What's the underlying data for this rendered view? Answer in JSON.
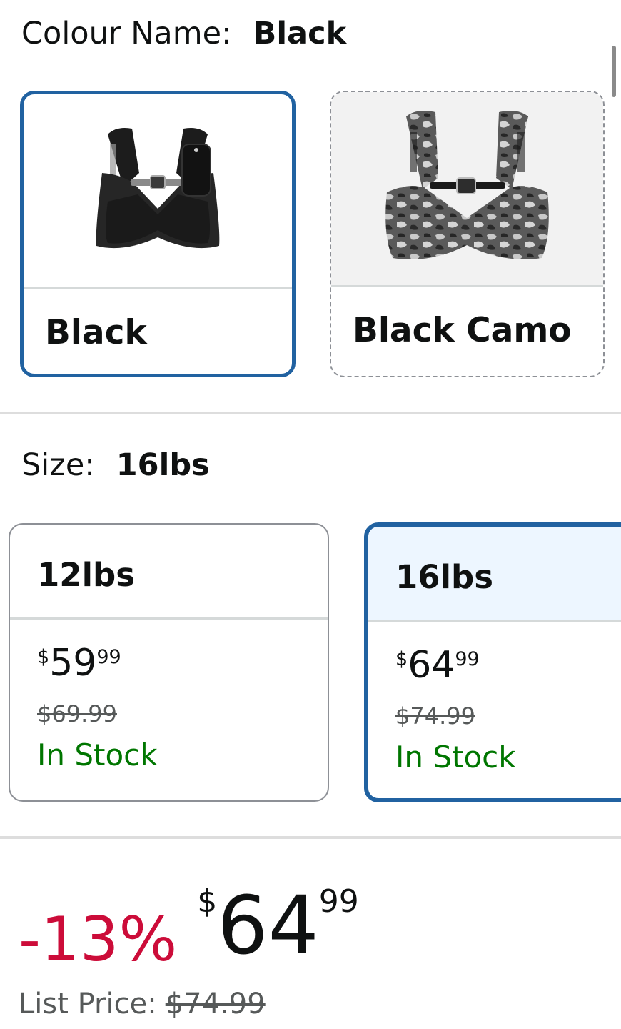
{
  "colour": {
    "label": "Colour Name:",
    "selected": "Black",
    "options": [
      {
        "name": "Black",
        "icon": "weight-vest-black-image",
        "state": "selected"
      },
      {
        "name": "Black Camo",
        "icon": "weight-vest-black-camo-image",
        "state": "unavailable"
      }
    ]
  },
  "size": {
    "label": "Size:",
    "selected": "16lbs",
    "options": [
      {
        "name": "12lbs",
        "currency": "$",
        "whole": "59",
        "fraction": "99",
        "list_price": "$69.99",
        "availability": "In Stock"
      },
      {
        "name": "16lbs",
        "currency": "$",
        "whole": "64",
        "fraction": "99",
        "list_price": "$74.99",
        "availability": "In Stock"
      }
    ]
  },
  "price": {
    "discount": "-13%",
    "currency": "$",
    "whole": "64",
    "fraction": "99",
    "list_price_label": "List Price:",
    "list_price": "$74.99"
  },
  "colors": {
    "accent": "#2162a1",
    "discount": "#cc0c39",
    "in_stock": "#007600"
  }
}
